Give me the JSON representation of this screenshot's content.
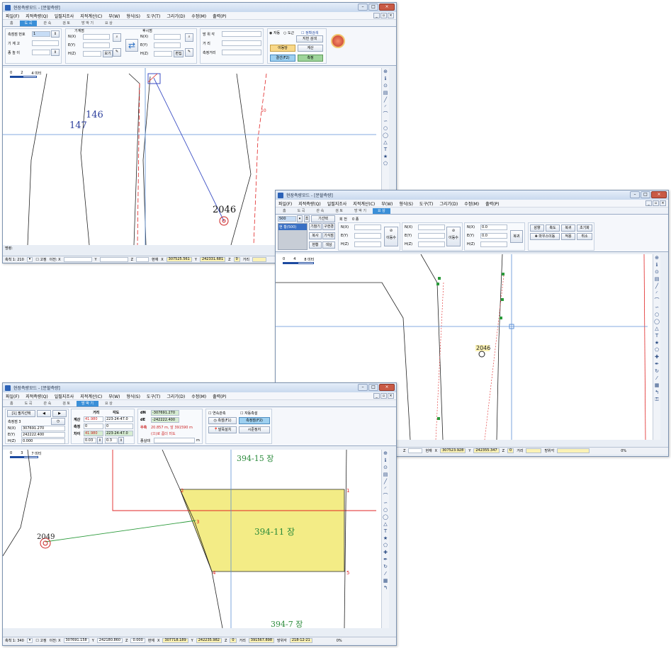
{
  "windows": {
    "w1": {
      "title": "현장측량모드 - [분할측량]",
      "menu": [
        "파일(F)",
        "지적측량(Q)",
        "일필지조사",
        "지적계산(C)",
        "부(W)",
        "형식(S)",
        "도구(T)",
        "그리기(D)",
        "수정(M)",
        "출력(P)"
      ],
      "tabs": [
        "홈",
        "도 곡",
        "관 숙",
        "검 토",
        "방 박 기",
        "요 상"
      ],
      "active_tab": 1,
      "panel": {
        "survey_no_label": "측점점 번호",
        "survey_no_value": "1",
        "instrument_height_label": "기 계 고",
        "target_height_label": "종 높 이",
        "machine_point_label": "기계점",
        "back_point_label": "후시점",
        "n_label": "N(X)",
        "e_label": "E(Y)",
        "h_label": "H(Z)",
        "view_btn": "보기",
        "edit_btn": "편집",
        "azimuth_label": "방 위 각",
        "distance_label": "거 리",
        "measured_dist_label": "측정거리",
        "auto_label": "자동",
        "manual_label": "도근",
        "correct_label": "정확검색",
        "jibun_search": "지번 검색",
        "calc_btn": "계산",
        "set_btn": "이동당",
        "survey_btn": "결선(F2)",
        "measure_btn": "측정"
      },
      "scale": {
        "t0": "0",
        "t1": "2",
        "t2": "4 미터"
      },
      "map_labels": {
        "a": "146",
        "b": "147",
        "c": "2046",
        "d": "10"
      },
      "status": {
        "label": "축척 1: 210",
        "height": "고정",
        "h_text": "이전: X",
        "y": "Y",
        "z": "Z",
        "current": "현재",
        "cx": "307525.561",
        "cy": "242331.681",
        "cz": "0",
        "dist": "거리"
      },
      "prompt": "명령:"
    },
    "w2": {
      "title": "현장측량모드 - [분할측량]",
      "menu": [
        "파일(F)",
        "지적측량(Q)",
        "일필지조사",
        "지적계산(C)",
        "부(W)",
        "형식(S)",
        "도구(T)",
        "그리기(D)",
        "수정(M)",
        "출력(P)"
      ],
      "tabs": [
        "홈",
        "도 곡",
        "관 숙",
        "검 토",
        "방 박 기",
        "요 상"
      ],
      "active_tab": 5,
      "panel": {
        "select_value": "500",
        "line_select": "기선택",
        "rotate_label": "회 전",
        "rotate_value": "0 종",
        "list_item": "현 황(500)",
        "b1": "기참기",
        "b2": "구현경",
        "b3": "복사",
        "b4": "기식점",
        "b5": "현황",
        "b6": "색상",
        "n_label": "N(X)",
        "e_label": "E(Y)",
        "h_label": "H(Z)",
        "move_btn": "이동수",
        "move_btn2": "이동수",
        "n3": "0.0",
        "e3": "0.0",
        "move3": "복귀",
        "r1": [
          "삼향",
          "축도",
          "복귀",
          "초기화"
        ],
        "r2": [
          "마우스이동",
          "적용",
          "취소"
        ]
      },
      "scale": {
        "t0": "0",
        "t1": "4",
        "t2": "8 미터"
      },
      "map_labels": {
        "a": "2046"
      },
      "status": {
        "z": "Z",
        "current": "현재",
        "cx": "307523.928",
        "cy": "242355.347",
        "cz": "0",
        "dist": "거리",
        "azimuth": "방위각",
        "pct": "0%"
      }
    },
    "w3": {
      "title": "현장측량모드 - [분할측량]",
      "menu": [
        "파일(F)",
        "지적측량(Q)",
        "일필지조사",
        "지적계산(C)",
        "부(W)",
        "형식(S)",
        "도구(T)",
        "그리기(D)",
        "수정(M)",
        "출력(P)"
      ],
      "tabs": [
        "홈",
        "도 곡",
        "관 숙",
        "검 토",
        "방 박 기",
        "요 상"
      ],
      "active_tab": 4,
      "panel": {
        "parcel_select": "[1] 필지선택",
        "point_label": "측정점 3",
        "n_label": "N(X)",
        "n_value": "307691.270",
        "e_label": "E(Y)",
        "e_value": "242222.400",
        "h_label": "H(Z)",
        "h_value": "0.000",
        "dist_hdr": "거리",
        "angle_hdr": "각도",
        "calc_label": "계산",
        "calc_dist": "41.980",
        "calc_angle": "223-24-47.0",
        "meas_label": "측정",
        "meas_dist": "0",
        "meas_angle": "0",
        "diff_label": "차이",
        "diff_dist": "41.980",
        "diff_angle": "223-24-47.0",
        "step1": "0.03",
        "step2": "0.3",
        "dn_label": "dN",
        "dn_value": "-307691.270",
        "de_label": "dE",
        "de_value": "-242222.400",
        "front_label": "우측",
        "front_text": "20.857 m, 앞 391590 m",
        "hint": "(으)로 좀더 미도",
        "done_label": "종실태",
        "done_unit": "m",
        "cont_label": "연속관측",
        "auto_label": "자동측설",
        "measure_btn": "측점(F1)",
        "point_btn": "측정점(F2)",
        "pin_btn": "말뚝설치",
        "prism_btn": "시준정지"
      },
      "scale": {
        "t0": "0",
        "t1": "3",
        "t2": "7 미터"
      },
      "map_labels": {
        "parcel_main": "394-11 장",
        "parcel_top": "394-15 장",
        "parcel_bottom": "394-7 장",
        "p1": "1",
        "p2": "2",
        "p3": "3",
        "p4": "4",
        "p5": "5",
        "mark": "2049"
      },
      "status": {
        "label": "축척 1: 340",
        "height": "고정",
        "prev": "이전: X",
        "px": "307691.158",
        "py": "Y",
        "pyv": "242180.860",
        "pz": "Z",
        "pzv": "0.000",
        "current": "현재",
        "x": "X",
        "cx": "307718.189",
        "y": "Y",
        "cy": "242235.982",
        "z": "Z",
        "cz": "0",
        "dist": "거리",
        "dist_v": "391567.898",
        "azimuth": "방위각",
        "az_v": "218-12-21",
        "pct": "0%"
      }
    }
  },
  "colors": {
    "accent": "#3a8fd8",
    "parcel_fill": "#f3ec86",
    "red_line": "#e02424",
    "blue_line": "#3c6fd0"
  }
}
